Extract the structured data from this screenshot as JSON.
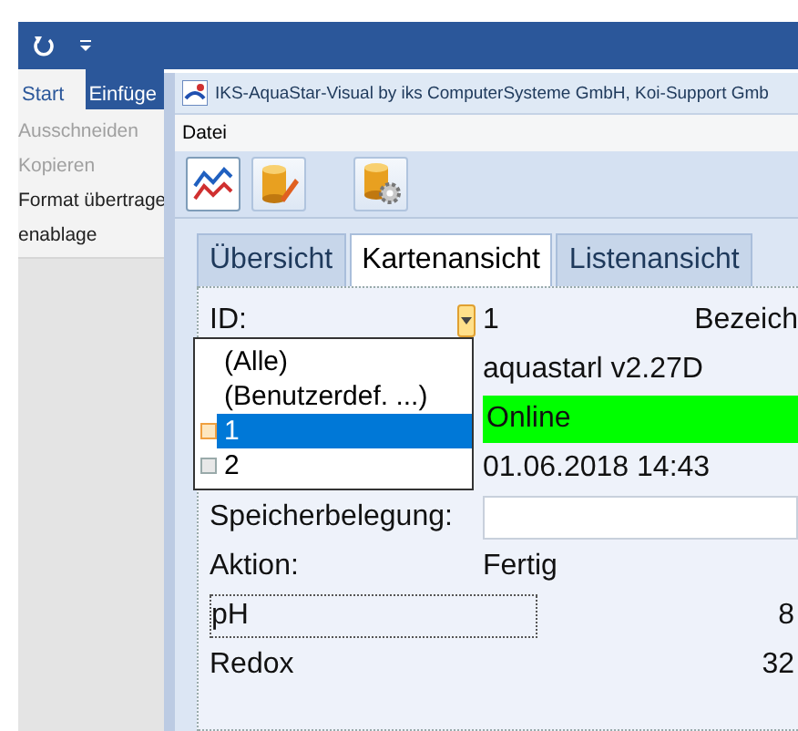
{
  "word": {
    "tabs": [
      {
        "label": "Start",
        "selected": true
      },
      {
        "label": "Einfüge",
        "selected": false
      }
    ],
    "clipboard_items": [
      {
        "label": "Ausschneiden",
        "disabled": true
      },
      {
        "label": "Kopieren",
        "disabled": true
      },
      {
        "label": "Format übertrage",
        "disabled": false
      }
    ],
    "group_label": "enablage"
  },
  "app": {
    "title": "IKS-AquaStar-Visual by iks ComputerSysteme GmbH, Koi-Support Gmb",
    "menu": [
      "Datei"
    ],
    "tabs": [
      {
        "label": "Übersicht",
        "selected": false
      },
      {
        "label": "Kartenansicht",
        "selected": true
      },
      {
        "label": "Listenansicht",
        "selected": false
      }
    ],
    "id_label": "ID:",
    "id_value": "1",
    "name_label": "Bezeich",
    "version": "aquastarl v2.27D",
    "status": {
      "text": "Online",
      "color": "#00ff00"
    },
    "timestamp": "01.06.2018 14:43",
    "memory_label": "Speicherbelegung:",
    "action_label": "Aktion:",
    "action_value": "Fertig",
    "measurements": [
      {
        "name": "pH",
        "value": "8",
        "focused": true
      },
      {
        "name": "Redox",
        "value": "32",
        "focused": false
      }
    ],
    "dropdown": [
      {
        "label": "(Alle)",
        "kind": "plain",
        "selected": false
      },
      {
        "label": "(Benutzerdef. ...)",
        "kind": "plain",
        "selected": false
      },
      {
        "label": "1",
        "kind": "check",
        "selected": true
      },
      {
        "label": "2",
        "kind": "check",
        "selected": false
      }
    ]
  }
}
